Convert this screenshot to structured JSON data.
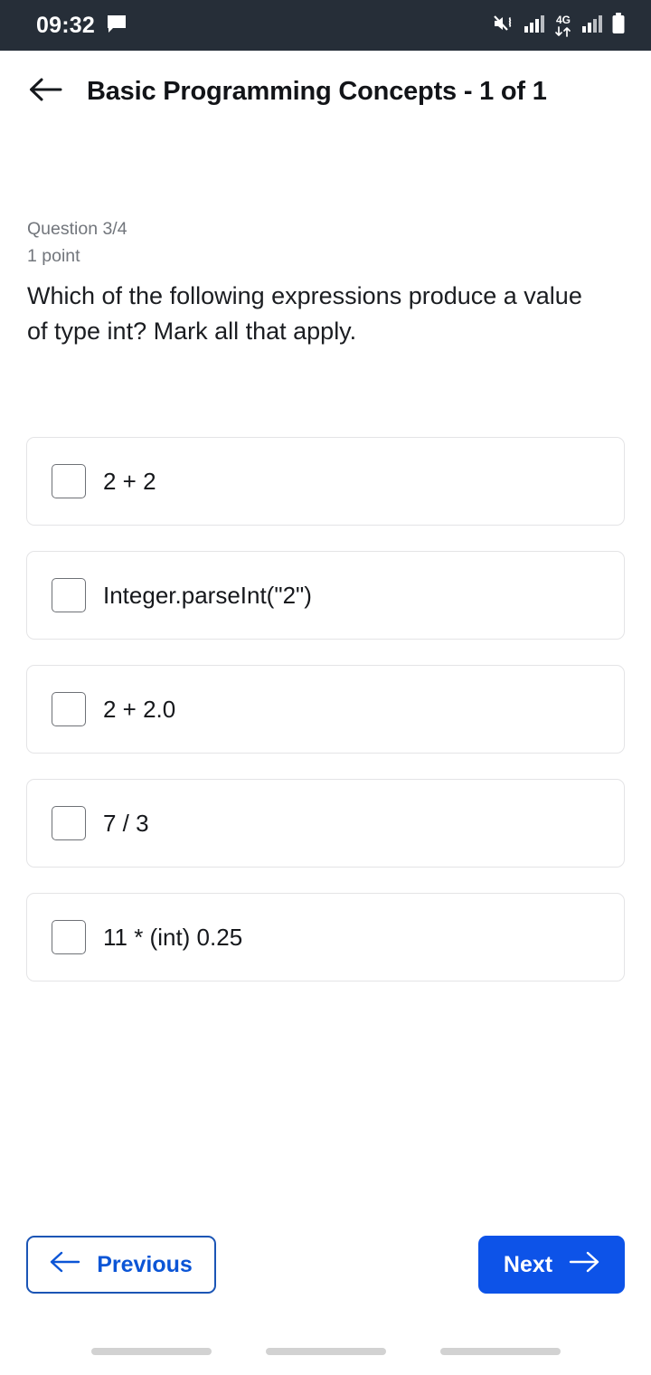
{
  "status_bar": {
    "time": "09:32",
    "network_label": "4G",
    "icons": [
      "message-bubble-icon",
      "mute-vibrate-icon",
      "signal-bars-icon",
      "data-transfer-icon",
      "signal-bars-secondary-icon",
      "battery-icon"
    ],
    "background_color": "#262E38"
  },
  "app_bar": {
    "back_icon": "back-arrow-icon",
    "title": "Basic Programming Concepts - 1 of 1"
  },
  "question": {
    "counter": "Question 3/4",
    "points": "1 point",
    "prompt": "Which of the following expressions produce a value of type int? Mark all that apply."
  },
  "options": [
    {
      "label": "2 + 2",
      "checked": false
    },
    {
      "label": "Integer.parseInt(\"2\")",
      "checked": false
    },
    {
      "label": "2 + 2.0",
      "checked": false
    },
    {
      "label": "7 / 3",
      "checked": false
    },
    {
      "label": "11 * (int) 0.25",
      "checked": false
    }
  ],
  "navigation": {
    "previous_label": "Previous",
    "previous_icon": "arrow-left-icon",
    "next_label": "Next",
    "next_icon": "arrow-right-icon",
    "accent_color": "#0D53E8",
    "outline_color": "#1B55B5"
  }
}
